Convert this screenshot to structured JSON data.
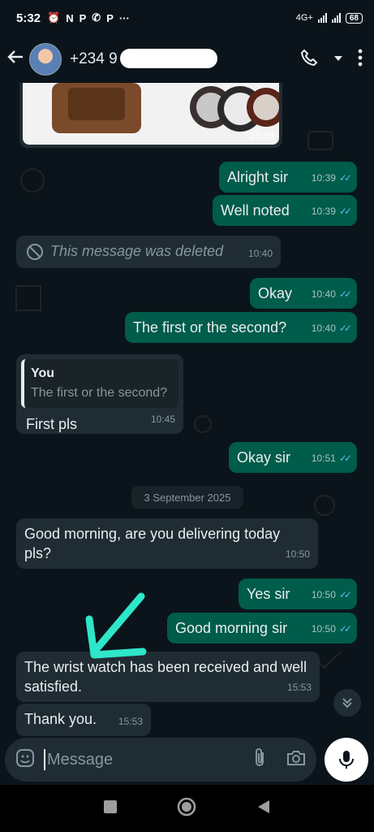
{
  "status": {
    "time": "5:32",
    "icons": [
      "⏰",
      "N",
      "P",
      "✆",
      "P",
      "···"
    ],
    "network": "4G+",
    "battery": "68"
  },
  "header": {
    "contact": "+234 9",
    "icons": [
      "back-arrow-icon",
      "avatar",
      "phone-icon",
      "dropdown-icon",
      "more-icon"
    ]
  },
  "messages": [
    {
      "type": "image",
      "time": "10:39"
    },
    {
      "dir": "out",
      "text": "Alright sir",
      "time": "10:39"
    },
    {
      "dir": "out",
      "text": "Well noted",
      "time": "10:39"
    },
    {
      "dir": "in",
      "deleted": true,
      "text": "This message was deleted",
      "time": "10:40"
    },
    {
      "dir": "out",
      "text": "Okay",
      "time": "10:40"
    },
    {
      "dir": "out",
      "text": "The first or the second?",
      "time": "10:40"
    },
    {
      "dir": "in",
      "quote_name": "You",
      "quote_text": "The first or the second?",
      "text": "First pls",
      "time": "10:45"
    },
    {
      "dir": "out",
      "text": "Okay sir",
      "time": "10:51"
    },
    {
      "dir": "in",
      "text": "Good morning, are you delivering today pls?",
      "time": "10:50"
    },
    {
      "dir": "out",
      "text": "Yes sir",
      "time": "10:50"
    },
    {
      "dir": "out",
      "text": "Good morning sir",
      "time": "10:50"
    },
    {
      "dir": "in",
      "text": "The wrist watch has been received and well satisfied.",
      "time": "15:53"
    },
    {
      "dir": "in",
      "text": "Thank you.",
      "time": "15:53"
    }
  ],
  "date_chip": "3 September 2025",
  "composer": {
    "placeholder": "Message"
  },
  "colors": {
    "outgoing": "#005c4b",
    "incoming": "#202c33",
    "background": "#0b141a",
    "ticks": "#53bdeb",
    "annotation": "#2ee6c8"
  }
}
